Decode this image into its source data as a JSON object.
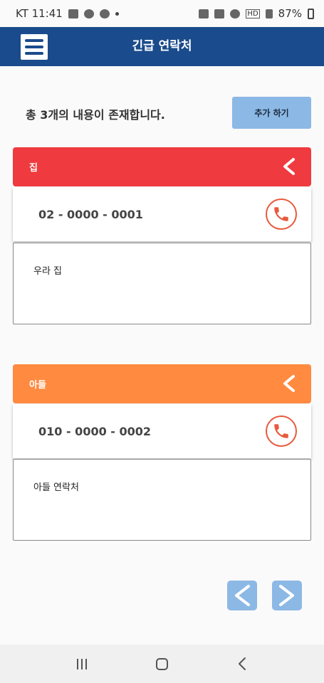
{
  "status_bar": {
    "carrier_time": "KT 11:41",
    "signal_text": "HD",
    "battery": "87%"
  },
  "header": {
    "title": "긴급 연락처",
    "menu_icon": "hamburger-menu-icon"
  },
  "summary": {
    "text": "총 3개의 내용이 존재합니다.",
    "add_label": "추가 하기"
  },
  "contacts": [
    {
      "name": "집",
      "phone": "02 - 0000 - 0001",
      "memo": "우라 집",
      "header_color": "#ef3b3f"
    },
    {
      "name": "아들",
      "phone": "010 - 0000 - 0002",
      "memo": "아들 연락처",
      "header_color": "#ff8a40"
    }
  ],
  "colors": {
    "app_bar": "#1a4b8c",
    "accent_button": "#8cb8e5",
    "call_icon": "#e85a3c"
  }
}
